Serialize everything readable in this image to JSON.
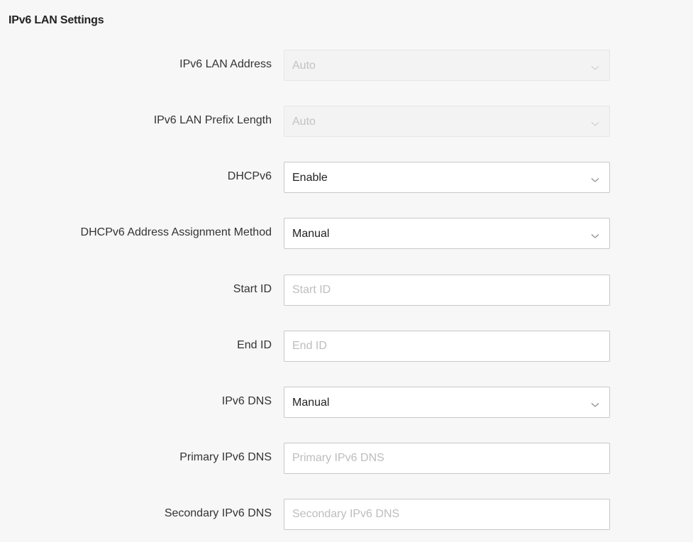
{
  "section": {
    "title": "IPv6 LAN Settings"
  },
  "fields": {
    "ipv6_lan_address": {
      "label": "IPv6 LAN Address",
      "value": "Auto",
      "disabled": true
    },
    "ipv6_lan_prefix_length": {
      "label": "IPv6 LAN Prefix Length",
      "value": "Auto",
      "disabled": true
    },
    "dhcpv6": {
      "label": "DHCPv6",
      "value": "Enable"
    },
    "dhcpv6_assignment_method": {
      "label": "DHCPv6 Address Assignment Method",
      "value": "Manual"
    },
    "start_id": {
      "label": "Start ID",
      "placeholder": "Start ID",
      "value": ""
    },
    "end_id": {
      "label": "End ID",
      "placeholder": "End ID",
      "value": ""
    },
    "ipv6_dns": {
      "label": "IPv6 DNS",
      "value": "Manual"
    },
    "primary_ipv6_dns": {
      "label": "Primary IPv6 DNS",
      "placeholder": "Primary IPv6 DNS",
      "value": ""
    },
    "secondary_ipv6_dns": {
      "label": "Secondary IPv6 DNS",
      "placeholder": "Secondary IPv6 DNS",
      "value": ""
    }
  },
  "icons": {
    "dropdown": "chevron-down-icon"
  },
  "colors": {
    "background": "#f7f7f7",
    "input_border": "#c8c8c8",
    "disabled_background": "#f3f3f3",
    "placeholder_text": "#bdbdbd"
  }
}
